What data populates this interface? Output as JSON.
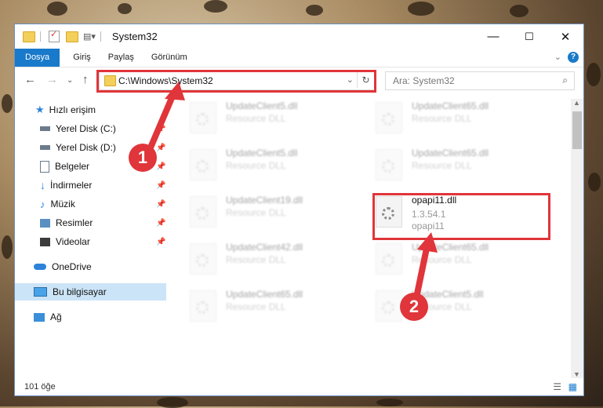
{
  "window": {
    "title": "System32"
  },
  "ribbon": {
    "tabs": [
      "Dosya",
      "Giriş",
      "Paylaş",
      "Görünüm"
    ]
  },
  "window_controls": {
    "minimize": "—",
    "maximize": "☐",
    "close": "✕"
  },
  "address": {
    "path": "C:\\Windows\\System32"
  },
  "search": {
    "placeholder": "Ara: System32"
  },
  "sidebar": {
    "items": [
      {
        "label": "Hızlı erişim",
        "icon": "star-icon",
        "pinned": false
      },
      {
        "label": "Yerel Disk (C:)",
        "icon": "drive-icon",
        "pinned": true
      },
      {
        "label": "Yerel Disk (D:)",
        "icon": "drive-icon",
        "pinned": true
      },
      {
        "label": "Belgeler",
        "icon": "documents-icon",
        "pinned": true
      },
      {
        "label": "İndirmeler",
        "icon": "download-icon",
        "pinned": true
      },
      {
        "label": "Müzik",
        "icon": "music-icon",
        "pinned": true
      },
      {
        "label": "Resimler",
        "icon": "pictures-icon",
        "pinned": true
      },
      {
        "label": "Videolar",
        "icon": "video-icon",
        "pinned": true
      },
      {
        "label": "OneDrive",
        "icon": "cloud-icon",
        "pinned": false
      },
      {
        "label": "Bu bilgisayar",
        "icon": "computer-icon",
        "pinned": false,
        "selected": true
      },
      {
        "label": "Ağ",
        "icon": "network-icon",
        "pinned": false
      }
    ]
  },
  "files": [
    {
      "name": "UpdateClient5.dll",
      "sub": "Resource DLL"
    },
    {
      "name": "UpdateClient65.dll",
      "sub": "Resource DLL"
    },
    {
      "name": "UpdateClient5.dll",
      "sub": "Resource DLL"
    },
    {
      "name": "UpdateClient65.dll",
      "sub": "Resource DLL"
    },
    {
      "name": "UpdateClient19.dll",
      "sub": "Resource DLL"
    },
    {
      "name": "opapi11.dll",
      "version": "1.3.54.1",
      "sub": "opapi11",
      "highlighted": true
    },
    {
      "name": "UpdateClient42.dll",
      "sub": "Resource DLL"
    },
    {
      "name": "UpdateClient65.dll",
      "sub": "Resource DLL"
    },
    {
      "name": "UpdateClient65.dll",
      "sub": "Resource DLL"
    },
    {
      "name": "UpdateClient5.dll",
      "sub": "Resource DLL"
    }
  ],
  "status": {
    "count": "101 öğe"
  },
  "annotations": {
    "badge1": "1",
    "badge2": "2",
    "color": "#e0353a"
  }
}
